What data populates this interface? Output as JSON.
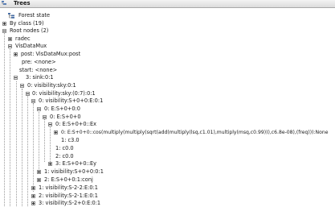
{
  "panel": {
    "title": "Trees"
  },
  "tree": {
    "forest_state": "Forest state",
    "by_class": "By class (19)",
    "root_nodes": "Root nodes (2)",
    "radec": "radec",
    "visdatamux": "VisDataMux",
    "post": "post: VisDataMux:post",
    "pre": "pre: <none>",
    "start": "start: <none>",
    "sink": "3: sink:0:1",
    "vis_sky": "0: visibility:sky:0:1",
    "vis_sky_07": "0: visibility:sky:(0:7):0:1",
    "vis_s000": "0: visibility:S+0+0:E:0:1",
    "es000": "0: E:S+0+0:0",
    "es00_0": "0: E:S+0+0",
    "es00_ex": "0: E:S+0+0::Ex",
    "cos_expr": "0: E:S+0+0::cos(multiply(multiply(sqrt(add(multiply(lsq,c1.01),multiply(msq,c0.99))),c6.8e-08),(freq))):None",
    "c30": "1: c3.0",
    "c00a": "1: c0.0",
    "c00b": "2: c0.0",
    "ey": "3: E:S+0+0::Ey",
    "vis1": "1: visibility:S+0+0:0:1",
    "conj": "2: E:S+0+0:1:conj",
    "vis_s22": "1: visibility:S-2-2:E:0:1",
    "vis_s21": "2: visibility:S-2-1:E:0:1",
    "vis_s20": "3: visibility:S-2+0:E:0:1"
  }
}
